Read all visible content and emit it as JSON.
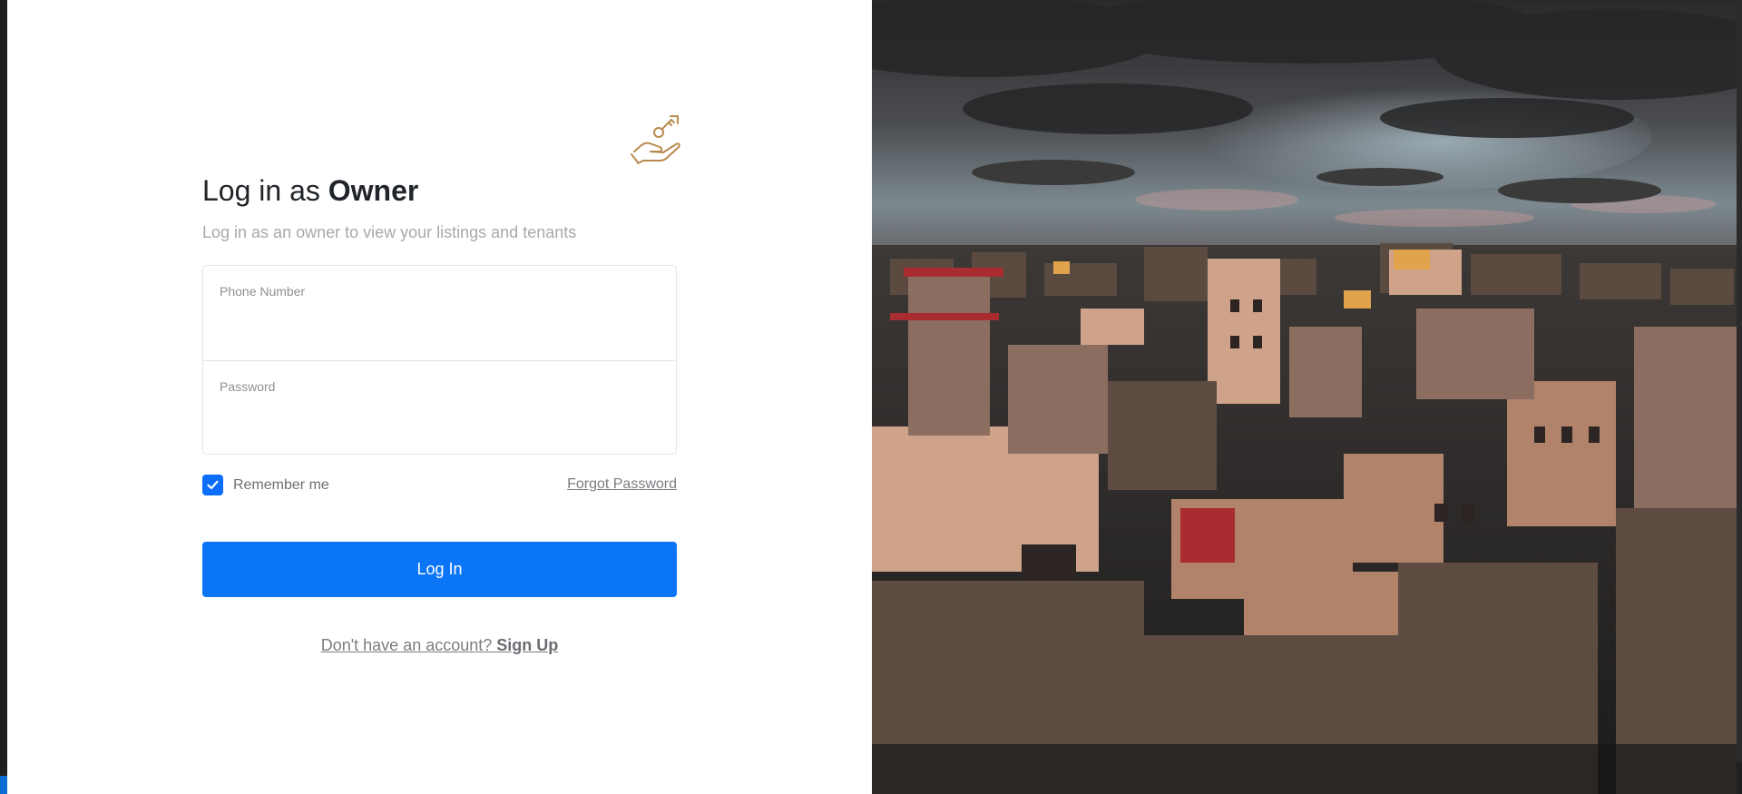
{
  "header": {
    "title_prefix": "Log in as",
    "title_emphasis": "Owner",
    "subtitle": "Log in as an owner to view your listings and tenants",
    "logo_icon": "hand-holding-key-icon"
  },
  "form": {
    "phone": {
      "label": "Phone Number",
      "value": ""
    },
    "password": {
      "label": "Password",
      "value": ""
    },
    "remember": {
      "label": "Remember me",
      "checked": true
    },
    "forgot_label": "Forgot Password",
    "submit_label": "Log In"
  },
  "footer": {
    "prompt": "Don't have an account?",
    "signup_label": "Sign Up"
  },
  "theme": {
    "primary": "#0a75f7",
    "logo_color": "#b98a4e"
  }
}
